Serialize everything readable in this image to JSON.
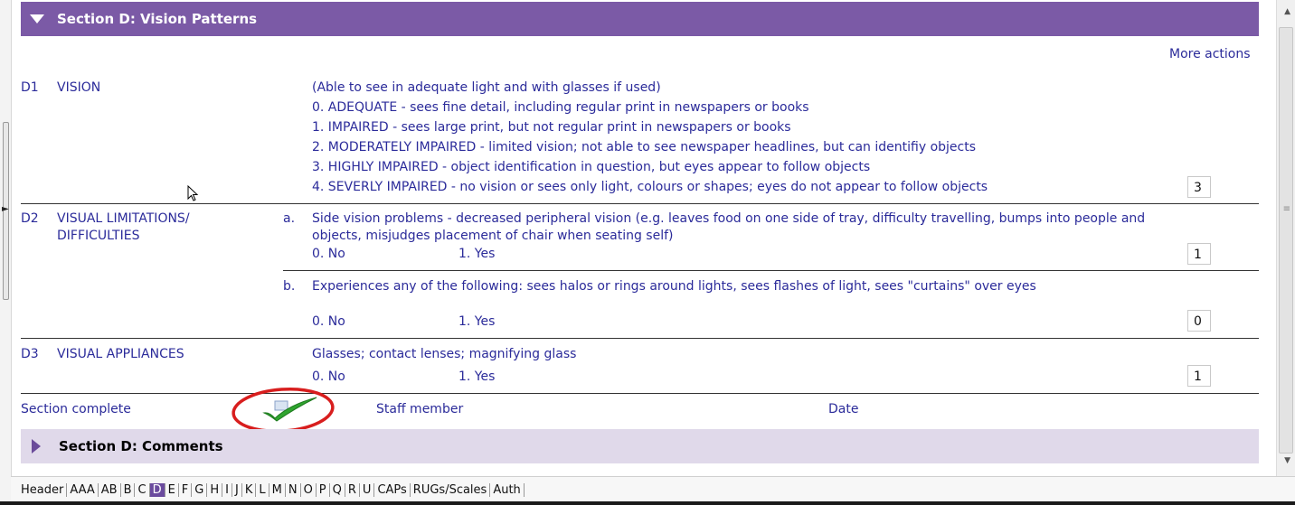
{
  "section": {
    "title": "Section D: Vision Patterns"
  },
  "more_actions": "More actions",
  "d1": {
    "code": "D1",
    "label": "VISION",
    "intro": "(Able to see in adequate light and with glasses if used)",
    "options": [
      "0. ADEQUATE - sees fine detail, including regular print in newspapers or books",
      "1. IMPAIRED - sees large print, but not regular print in newspapers or books",
      "2. MODERATELY IMPAIRED - limited vision; not able to see newspaper headlines, but can identifiy objects",
      "3. HIGHLY IMPAIRED - object identification in question, but eyes appear to follow objects",
      "4. SEVERLY IMPAIRED - no vision or sees only light, colours or shapes; eyes do not appear to follow objects"
    ],
    "value": "3"
  },
  "d2": {
    "code": "D2",
    "label_line1": "VISUAL LIMITATIONS/",
    "label_line2": "DIFFICULTIES",
    "a": {
      "letter": "a.",
      "text_line1": "Side vision problems - decreased peripheral vision (e.g. leaves food on one side of tray, difficulty travelling, bumps into people and",
      "text_line2": "objects, misjudges placement of chair when seating self)",
      "no": "0. No",
      "yes": "1. Yes",
      "value": "1"
    },
    "b": {
      "letter": "b.",
      "text": "Experiences any of the following: sees halos or rings around lights, sees flashes of light, sees \"curtains\" over eyes",
      "no": "0. No",
      "yes": "1. Yes",
      "value": "0"
    }
  },
  "d3": {
    "code": "D3",
    "label": "VISUAL APPLIANCES",
    "text": "Glasses; contact lenses; magnifying glass",
    "no": "0. No",
    "yes": "1. Yes",
    "value": "1"
  },
  "footer_row": {
    "section_complete": "Section complete",
    "staff_member": "Staff member",
    "date": "Date"
  },
  "comments": {
    "title": "Section D: Comments"
  },
  "tabs": [
    "Header",
    "AAA",
    "AB",
    "B",
    "C",
    "D",
    "E",
    "F",
    "G",
    "H",
    "I",
    "J",
    "K",
    "L",
    "M",
    "N",
    "O",
    "P",
    "Q",
    "R",
    "U",
    "CAPs",
    "RUGs/Scales",
    "Auth"
  ],
  "active_tab": "D",
  "colors": {
    "header_purple": "#7b5aa6",
    "text_blue": "#2b2b9a",
    "check_green": "#2fa52f",
    "circle_red": "#d81e1e"
  }
}
